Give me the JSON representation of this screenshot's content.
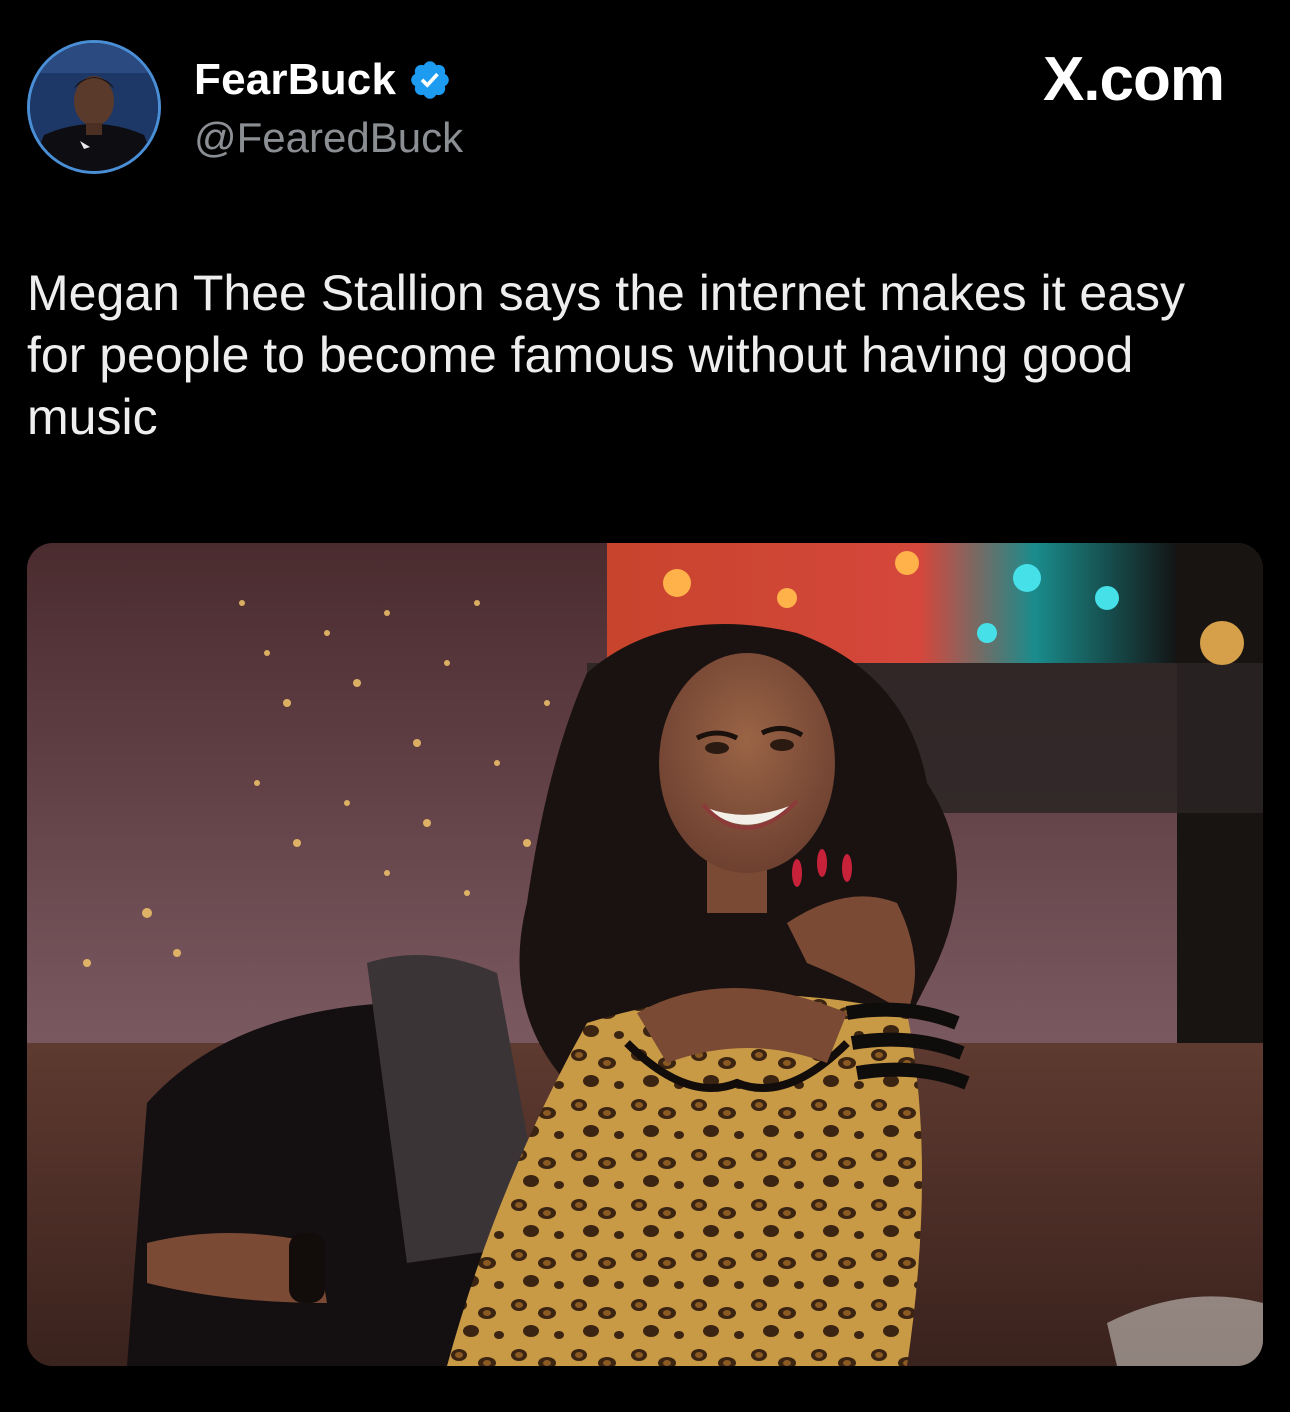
{
  "author": {
    "display_name": "FearBuck",
    "handle": "@FearedBuck",
    "verified": true,
    "avatar_icon": "profile-photo"
  },
  "source_label": "X.com",
  "tweet": {
    "text": "Megan Thee Stallion says the internet makes it easy for people to become famous without having good music"
  },
  "media": {
    "type": "photo"
  },
  "colors": {
    "background": "#000000",
    "verified_badge": "#1d9bf0",
    "handle_text": "#8b8f94",
    "primary_text": "#ffffff"
  }
}
